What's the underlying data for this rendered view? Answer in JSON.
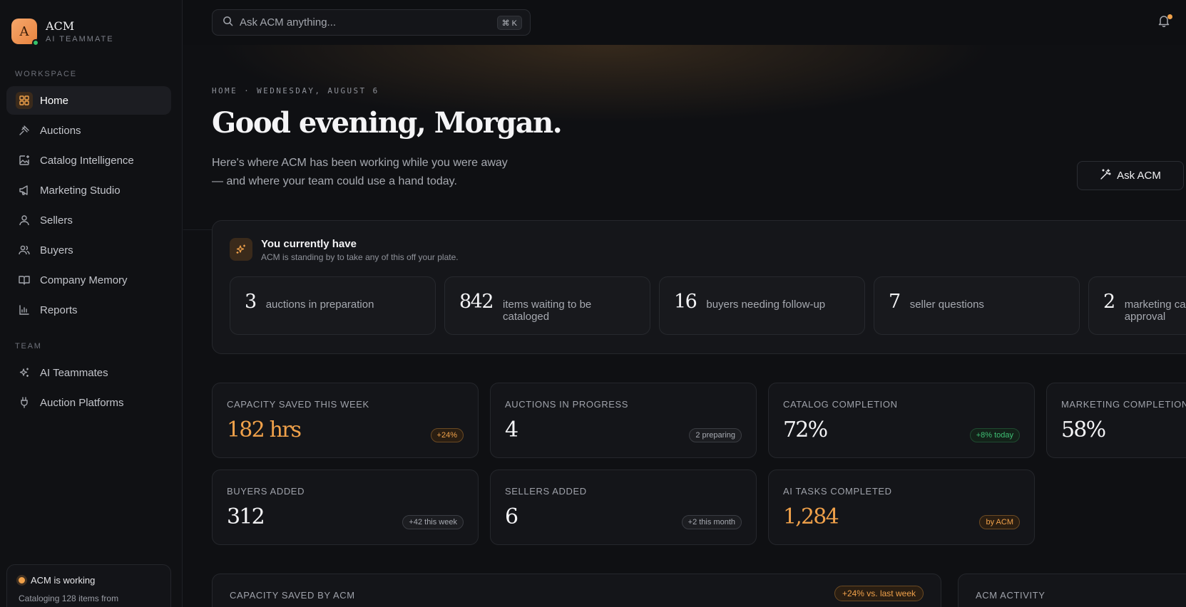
{
  "brand": {
    "initial": "A",
    "name": "ACM",
    "subtitle": "AI TEAMMATE"
  },
  "sidebar": {
    "workspace_label": "WORKSPACE",
    "workspace_items": [
      {
        "label": "Home",
        "icon": "grid-icon",
        "active": true
      },
      {
        "label": "Auctions",
        "icon": "gavel-icon"
      },
      {
        "label": "Catalog Intelligence",
        "icon": "image-sparkle-icon"
      },
      {
        "label": "Marketing Studio",
        "icon": "megaphone-icon"
      },
      {
        "label": "Sellers",
        "icon": "user-icon"
      },
      {
        "label": "Buyers",
        "icon": "users-icon"
      },
      {
        "label": "Company Memory",
        "icon": "book-icon"
      },
      {
        "label": "Reports",
        "icon": "bar-chart-icon"
      }
    ],
    "team_label": "TEAM",
    "team_items": [
      {
        "label": "AI Teammates",
        "icon": "sparkles-icon"
      },
      {
        "label": "Auction Platforms",
        "icon": "plug-icon"
      }
    ],
    "status": {
      "title": "ACM is working",
      "detail": "Cataloging 128 items from"
    }
  },
  "search": {
    "placeholder": "Ask ACM anything...",
    "shortcut": "⌘ K"
  },
  "hero": {
    "breadcrumb": "HOME · WEDNESDAY, AUGUST 6",
    "greeting": "Good evening, Morgan.",
    "intro": "Here's where ACM has been working while you were away — and where your team could use a hand today.",
    "ask_button": "Ask ACM"
  },
  "plate": {
    "title": "You currently have",
    "subtitle": "ACM is standing by to take any of this off your plate.",
    "items": [
      {
        "num": "3",
        "label": "auctions in preparation"
      },
      {
        "num": "842",
        "label": "items waiting to be cataloged"
      },
      {
        "num": "16",
        "label": "buyers needing follow-up"
      },
      {
        "num": "7",
        "label": "seller questions"
      },
      {
        "num": "2",
        "label": "marketing campaigns awaiting approval"
      }
    ]
  },
  "stats": [
    {
      "label": "CAPACITY SAVED THIS WEEK",
      "value": "182 hrs",
      "badge": "+24%",
      "tone": "orange",
      "accent": true
    },
    {
      "label": "AUCTIONS IN PROGRESS",
      "value": "4",
      "badge": "2 preparing",
      "tone": "neutral"
    },
    {
      "label": "CATALOG COMPLETION",
      "value": "72%",
      "badge": "+8% today",
      "tone": "green"
    },
    {
      "label": "MARKETING COMPLETION",
      "value": "58%",
      "badge": "",
      "tone": "neutral"
    },
    {
      "label": "BUYERS ADDED",
      "value": "312",
      "badge": "+42 this week",
      "tone": "neutral"
    },
    {
      "label": "SELLERS ADDED",
      "value": "6",
      "badge": "+2 this month",
      "tone": "neutral"
    },
    {
      "label": "AI TASKS COMPLETED",
      "value": "1,284",
      "badge": "by ACM",
      "tone": "orange",
      "accent": true
    }
  ],
  "bottom": {
    "capacity_label": "CAPACITY SAVED BY ACM",
    "capacity_badge": "+24% vs. last week",
    "activity_label": "ACM ACTIVITY"
  }
}
